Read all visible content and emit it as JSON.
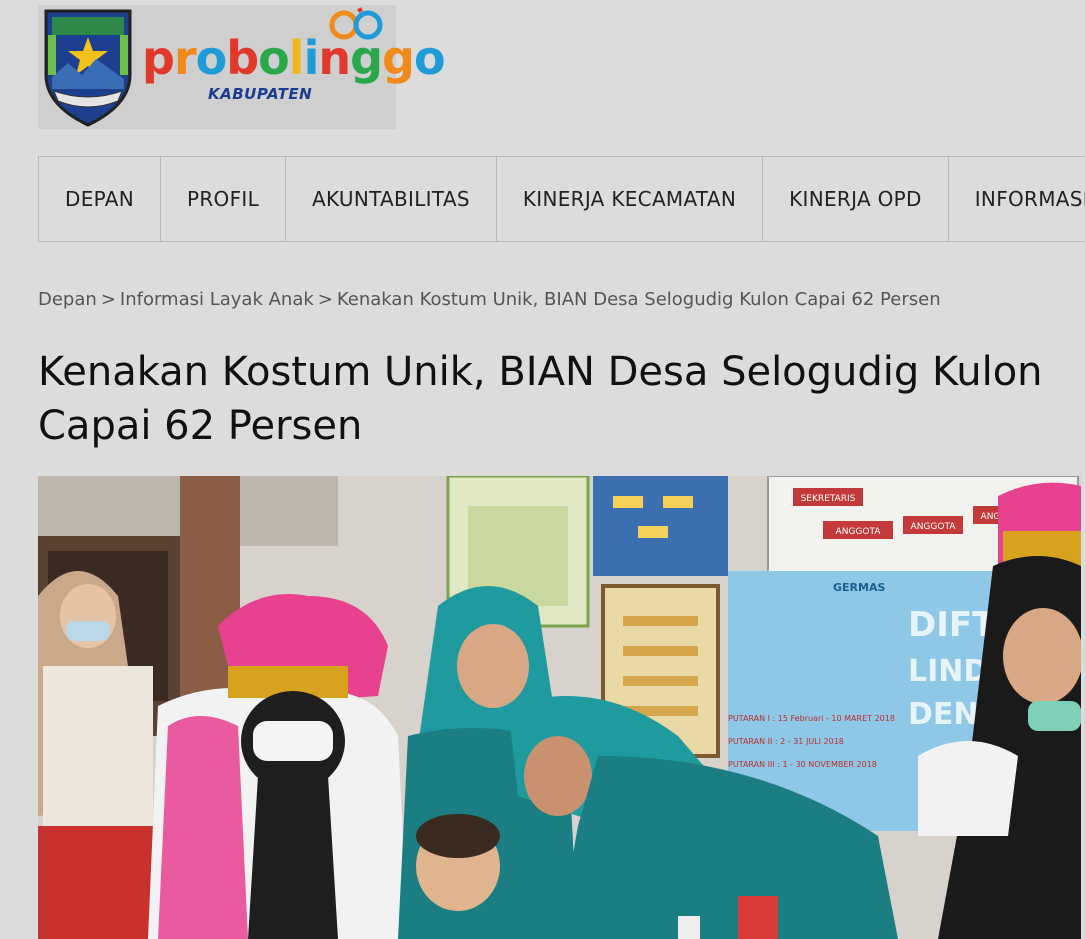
{
  "header": {
    "logo_word": "probolinggo",
    "logo_sub": "KABUPATEN",
    "logo_badge": "60"
  },
  "nav": {
    "items": [
      {
        "label": "DEPAN"
      },
      {
        "label": "PROFIL"
      },
      {
        "label": "AKUNTABILITAS"
      },
      {
        "label": "KINERJA KECAMATAN"
      },
      {
        "label": "KINERJA OPD"
      },
      {
        "label": "INFORMASI"
      }
    ]
  },
  "breadcrumb": {
    "home": "Depan",
    "category": "Informasi Layak Anak",
    "current": "Kenakan Kostum Unik, BIAN Desa Selogudig Kulon Capai 62 Persen",
    "separator": ">"
  },
  "article": {
    "title": "Kenakan Kostum Unik, BIAN Desa Selogudig Kulon Capai 62 Persen"
  },
  "photo": {
    "poster_text_1": "DIFTER",
    "poster_text_2": "LINDUN",
    "poster_text_3": "DENGAN",
    "poster_lines": [
      "PUTARAN I : 15 Februari - 10 MARET 2018",
      "PUTARAN II : 2 - 31 JULI 2018",
      "PUTARAN III : 1 - 30 NOVEMBER 2018"
    ],
    "poster_brand": "GERMAS",
    "chart_boxes": [
      "SEKRETARIS",
      "ANGGOTA",
      "ANGGOTA",
      "ANGGOTA"
    ]
  },
  "colors": {
    "teal_hijab": "#1f9a9e",
    "pink_feather": "#e8418f",
    "gold_crown": "#d8a21e",
    "poster_blue": "#8fc7e6"
  }
}
